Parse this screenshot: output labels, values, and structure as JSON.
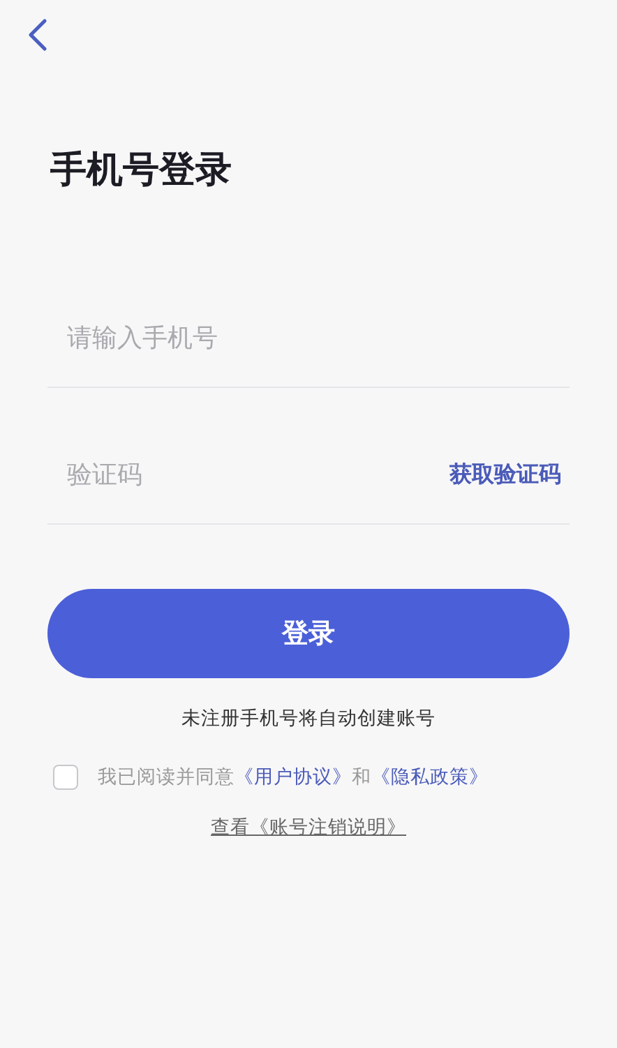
{
  "title": "手机号登录",
  "phone_field": {
    "placeholder": "请输入手机号"
  },
  "code_field": {
    "placeholder": "验证码"
  },
  "get_code_button": "获取验证码",
  "login_button": "登录",
  "hint": "未注册手机号将自动创建账号",
  "agreement": {
    "checked": false,
    "text": "我已阅读并同意",
    "link_1": "《用户协议》",
    "conjunction": "和",
    "link_2": "《隐私政策》"
  },
  "account_cancel_link": "查看《账号注销说明》"
}
